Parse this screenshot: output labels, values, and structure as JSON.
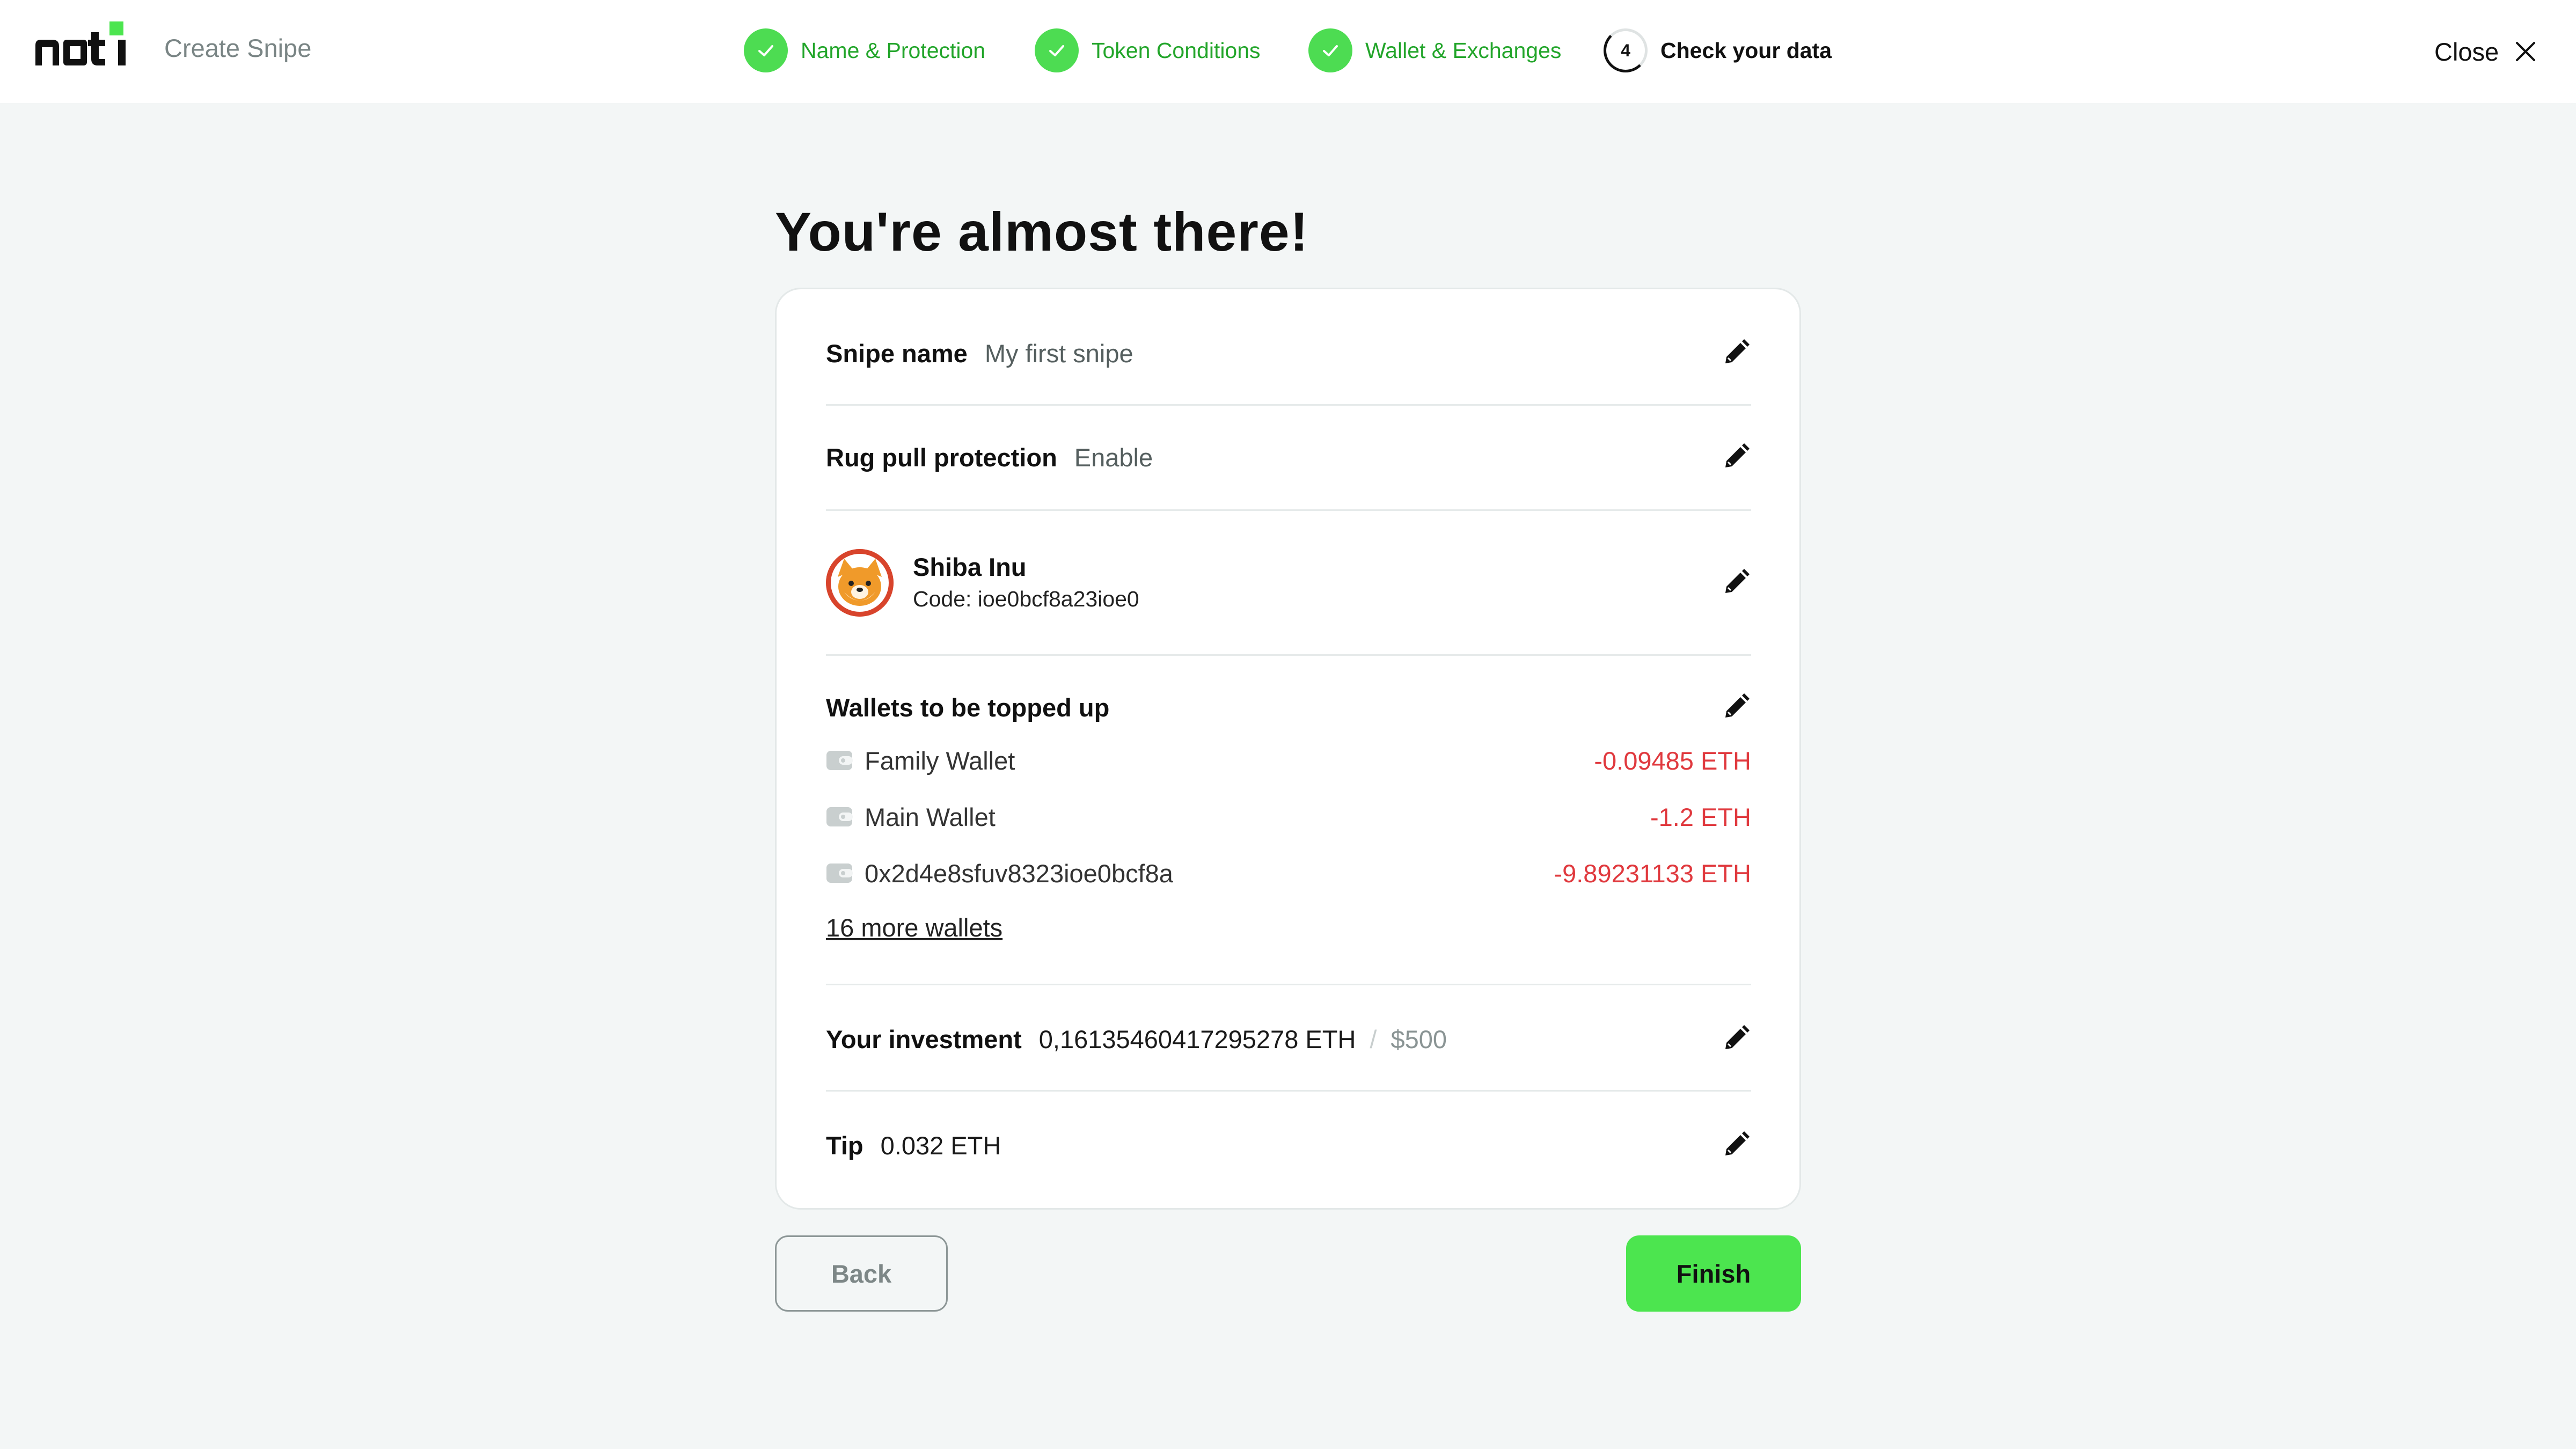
{
  "header": {
    "logo_text": "noti",
    "app_title": "Create Snipe",
    "steps": [
      {
        "label": "Name & Protection",
        "status": "done"
      },
      {
        "label": "Token Conditions",
        "status": "done"
      },
      {
        "label": "Wallet & Exchanges",
        "status": "done"
      },
      {
        "label": "Check your data",
        "status": "current",
        "number": "4"
      }
    ],
    "close_label": "Close"
  },
  "main": {
    "title": "You're almost there!",
    "snipe_name": {
      "label": "Snipe name",
      "value": "My first snipe"
    },
    "rug_pull": {
      "label": "Rug pull protection",
      "value": "Enable"
    },
    "token": {
      "name": "Shiba Inu",
      "code": "Code: ioe0bcf8a23ioe0"
    },
    "wallets": {
      "title": "Wallets to be topped up",
      "items": [
        {
          "name": "Family Wallet",
          "amount": "-0.09485 ETH"
        },
        {
          "name": "Main Wallet",
          "amount": "-1.2 ETH"
        },
        {
          "name": "0x2d4e8sfuv8323ioe0bcf8a",
          "amount": "-9.89231133 ETH"
        }
      ],
      "more_link": "16 more wallets"
    },
    "investment": {
      "label": "Your investment",
      "eth": "0,16135460417295278 ETH",
      "separator": "/",
      "usd": "$500"
    },
    "tip": {
      "label": "Tip",
      "value": "0.032 ETH"
    }
  },
  "actions": {
    "back_label": "Back",
    "finish_label": "Finish"
  },
  "colors": {
    "accent_green": "#4ce54f",
    "done_text_green": "#22a52a",
    "negative_red": "#e0393e",
    "background": "#f3f6f6"
  },
  "icons": {
    "step_done": "check-icon",
    "edit": "pencil-icon",
    "close": "close-icon",
    "wallet": "wallet-icon",
    "token": "shiba-inu-avatar"
  }
}
